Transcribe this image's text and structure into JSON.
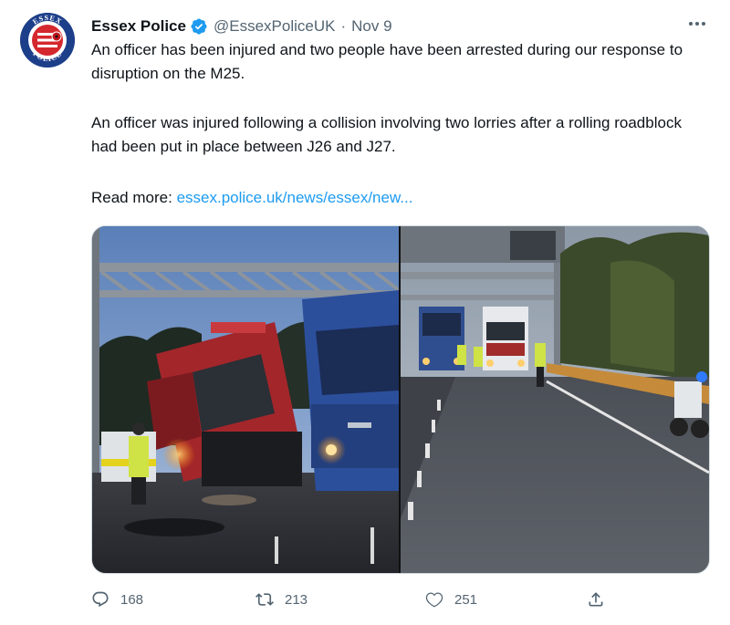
{
  "account": {
    "name": "Essex Police",
    "handle": "@EssexPoliceUK",
    "separator": "·",
    "date": "Nov 9",
    "logo_top_text": "ESSEX",
    "logo_bottom_text": "POLICE"
  },
  "tweet": {
    "paragraph1": "An officer has been injured and two people have been arrested during our response to disruption on the M25.",
    "paragraph2": "An officer was injured following a collision involving two lorries after a rolling roadblock had been put in place between J26 and J27.",
    "read_more_label": "Read more:",
    "link_text": "essex.police.uk/news/essex/new..."
  },
  "actions": {
    "replies": "168",
    "retweets": "213",
    "likes": "251"
  },
  "colors": {
    "link": "#1d9bf0",
    "muted": "#536471",
    "verified": "#1d9bf0",
    "avatar_bg": "#1d3f8a",
    "avatar_red": "#d5272e"
  },
  "icons": {
    "verified": "verified-badge-icon",
    "more": "more-horizontal-icon",
    "reply": "reply-icon",
    "retweet": "retweet-icon",
    "like": "heart-icon",
    "share": "share-icon"
  }
}
